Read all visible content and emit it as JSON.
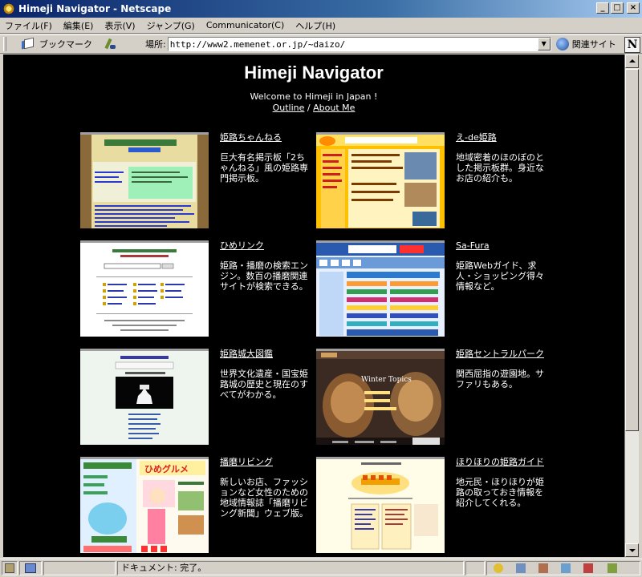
{
  "window": {
    "title": "Himeji Navigator - Netscape"
  },
  "menu": [
    "ファイル(F)",
    "編集(E)",
    "表示(V)",
    "ジャンプ(G)",
    "Communicator(C)",
    "ヘルプ(H)"
  ],
  "toolbar": {
    "bookmarks_label": "ブックマーク",
    "location_label": "場所:",
    "url": "http://www2.memenet.or.jp/~daizo/",
    "related_label": "関連サイト"
  },
  "page": {
    "title": "Himeji Navigator",
    "welcome": "Welcome to Himeji in Japan !",
    "outline_link": "Outline",
    "separator": "/",
    "about_link": "About Me"
  },
  "sites": [
    {
      "name": "姫路ちゃんねる",
      "desc": "巨大有名掲示板「2ちゃんねる」風の姫路専門掲示板。"
    },
    {
      "name": "え-de姫路",
      "desc": "地域密着のほのぼのとした掲示板群。身近なお店の紹介も。"
    },
    {
      "name": "ひめリンク",
      "desc": "姫路・播磨の検索エンジン。数百の播磨関連サイトが検索できる。"
    },
    {
      "name": "Sa-Fura",
      "desc": "姫路Webガイド、求人・ショッピング得々情報など。"
    },
    {
      "name": "姫路城大図鑑",
      "desc": "世界文化遺産・国宝姫路城の歴史と現在のすべてがわかる。"
    },
    {
      "name": "姫路セントラルパーク",
      "desc": "関西屈指の遊園地。サファリもある。"
    },
    {
      "name": "播磨リビング",
      "desc": "新しいお店、ファッションなど女性のための地域情報誌「播磨リビング新聞」ウェブ版。"
    },
    {
      "name": "ほりほりの姫路ガイド",
      "desc": "地元民・ほりほりが姫路の取っておき情報を紹介してくれる。"
    }
  ],
  "thumbs": {
    "t6_caption": "Winter Topics",
    "t7_caption": "ひめグルメ"
  },
  "status": {
    "text": "ドキュメント: 完了。"
  }
}
